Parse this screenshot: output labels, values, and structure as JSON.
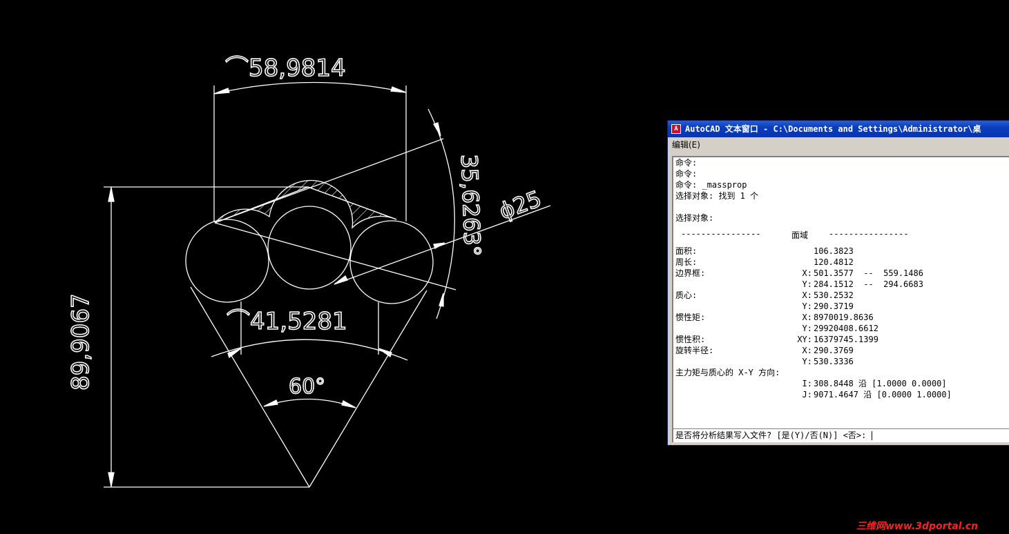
{
  "drawing": {
    "dim_arc_top": "⌒58,9814",
    "dim_arc_bottom": "⌒41,5281",
    "dim_angle_right": "35,6263°",
    "dim_diameter": "ϕ25",
    "dim_angle_bottom": "60°",
    "dim_height": "89,9067"
  },
  "text_window": {
    "title": "AutoCAD 文本窗口 - C:\\Documents and Settings\\Administrator\\桌",
    "menu_edit": "编辑(E)",
    "lines": [
      "命令:",
      "命令:",
      "命令: _massprop",
      "选择对象: 找到 1 个",
      "",
      "选择对象:"
    ],
    "divider_left": "----------------",
    "divider_title": "面域",
    "divider_right": "----------------",
    "props": [
      {
        "label": "面积:",
        "value": "106.3823"
      },
      {
        "label": "周长:",
        "value": "120.4812"
      },
      {
        "label": "边界框:",
        "axis": "X:",
        "value": "501.3577  --  559.1486"
      },
      {
        "label": "",
        "axis": "Y:",
        "value": "284.1512  --  294.6683"
      },
      {
        "label": "质心:",
        "axis": "X:",
        "value": "530.2532"
      },
      {
        "label": "",
        "axis": "Y:",
        "value": "290.3719"
      },
      {
        "label": "惯性矩:",
        "axis": "X:",
        "value": "8970019.8636"
      },
      {
        "label": "",
        "axis": "Y:",
        "value": "29920408.6612"
      },
      {
        "label": "惯性积:",
        "axis": "XY:",
        "value": "16379745.1399"
      },
      {
        "label": "旋转半径:",
        "axis": "X:",
        "value": "290.3769"
      },
      {
        "label": "",
        "axis": "Y:",
        "value": "530.3336"
      },
      {
        "label": "主力矩与质心的 X-Y 方向:",
        "axis": "",
        "value": ""
      },
      {
        "label": "",
        "axis": "I:",
        "value": "308.8448 沿 [1.0000 0.0000]"
      },
      {
        "label": "",
        "axis": "J:",
        "value": "9071.4647 沿 [0.0000 1.0000]"
      }
    ],
    "prompt": "是否将分析结果写入文件? [是(Y)/否(N)] <否>: "
  },
  "watermark": "三维网www.3dportal.cn"
}
